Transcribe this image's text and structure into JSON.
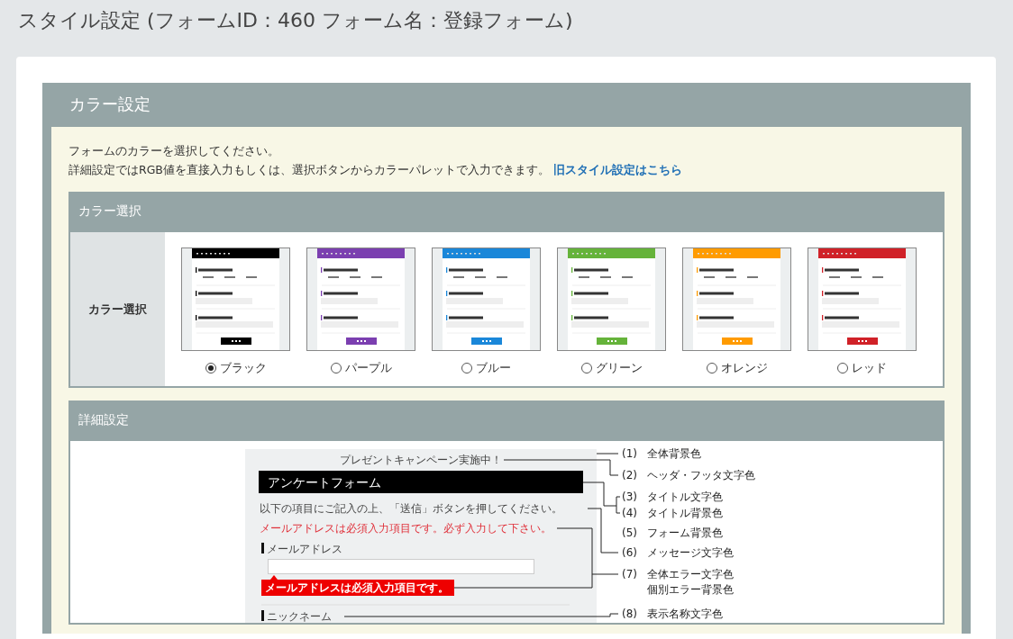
{
  "page_title": "スタイル設定 (フォームID：460 フォーム名：登録フォーム)",
  "color_settings": {
    "title": "カラー設定",
    "intro_lines": [
      "フォームのカラーを選択してください。",
      "詳細設定ではRGB値を直接入力もしくは、選択ボタンからカラーパレットで入力できます。"
    ],
    "old_style_link": "旧スタイル設定はこちら",
    "color_select": {
      "title": "カラー選択",
      "row_label": "カラー選択",
      "options": [
        {
          "label": "ブラック",
          "color": "#000000",
          "selected": true
        },
        {
          "label": "パープル",
          "color": "#7b3fb0",
          "selected": false
        },
        {
          "label": "ブルー",
          "color": "#1a87d9",
          "selected": false
        },
        {
          "label": "グリーン",
          "color": "#65b33a",
          "selected": false
        },
        {
          "label": "オレンジ",
          "color": "#ff9b00",
          "selected": false
        },
        {
          "label": "レッド",
          "color": "#d02128",
          "selected": false
        }
      ]
    },
    "detail": {
      "title": "詳細設定",
      "preview": {
        "header_text": "プレゼントキャンペーン実施中！",
        "form_title": "アンケートフォーム",
        "message": "以下の項目にご記入の上、「送信」ボタンを押してください。",
        "error_message": "メールアドレスは必須入力項目です。必ず入力して下さい。",
        "field_label": "メールアドレス",
        "field_error": "メールアドレスは必須入力項目です。",
        "next_field_label": "ニックネーム"
      },
      "legend": [
        {
          "number": "(1)",
          "lines": [
            "全体背景色"
          ]
        },
        {
          "number": "(2)",
          "lines": [
            "ヘッダ・フッタ文字色"
          ]
        },
        {
          "number": "(3)",
          "lines": [
            "タイトル文字色"
          ]
        },
        {
          "number": "(4)",
          "lines": [
            "タイトル背景色"
          ]
        },
        {
          "number": "(5)",
          "lines": [
            "フォーム背景色"
          ]
        },
        {
          "number": "(6)",
          "lines": [
            "メッセージ文字色"
          ]
        },
        {
          "number": "(7)",
          "lines": [
            "全体エラー文字色",
            "個別エラー背景色"
          ]
        },
        {
          "number": "(8)",
          "lines": [
            "表示名称文字色"
          ]
        }
      ]
    }
  }
}
